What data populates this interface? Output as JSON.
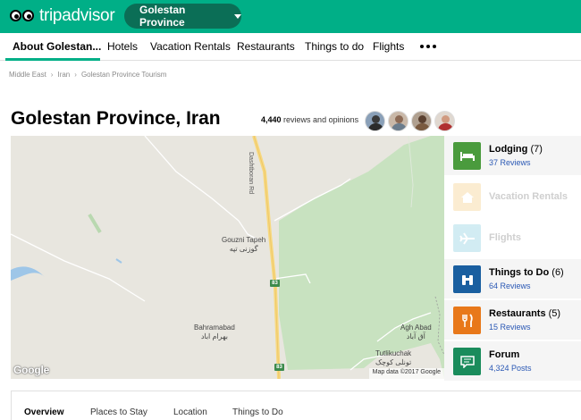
{
  "header": {
    "logo_text": "tripadvisor",
    "geo_pill_label": "Golestan Province",
    "brand_color": "#00af87",
    "pill_color": "#0b6e56"
  },
  "nav": {
    "tabs": [
      "About Golestan...",
      "Hotels",
      "Vacation Rentals",
      "Restaurants",
      "Things to do",
      "Flights"
    ],
    "active_tab": "About Golestan...",
    "more_icon": "more-dots-icon"
  },
  "breadcrumb": [
    "Middle East",
    "Iran",
    "Golestan Province Tourism"
  ],
  "title": {
    "text": "Golestan Province, Iran",
    "reviews_count": "4,440",
    "reviews_suffix": "reviews and opinions"
  },
  "map": {
    "labels": {
      "road_name": "Dashtboran Rd",
      "gouzni": "Gouzni Tapeh",
      "gouzni_fa": "گوزنی تپه",
      "bahramabad": "Bahramabad",
      "bahramabad_fa": "بهرام اباد",
      "agh_abad": "Agh Abad",
      "agh_abad_fa": "آق آباد",
      "tutlikuchak": "Tutlikuchak",
      "tutlikuchak_fa": "تونلی کوچک"
    },
    "shield_label": "83",
    "google_logo": "Google",
    "attribution": "Map data ©2017 Google"
  },
  "categories": [
    {
      "name": "Lodging",
      "count": "(7)",
      "sub": "37 Reviews",
      "icon": "bed-icon",
      "color": "#4a9b3d",
      "enabled": true
    },
    {
      "name": "Vacation Rentals",
      "count": "",
      "sub": "",
      "icon": "house-icon",
      "color": "#f5c26b",
      "enabled": false
    },
    {
      "name": "Flights",
      "count": "",
      "sub": "",
      "icon": "plane-icon",
      "color": "#6ec3d8",
      "enabled": false
    },
    {
      "name": "Things to Do",
      "count": "(6)",
      "sub": "64 Reviews",
      "icon": "binoculars-icon",
      "color": "#1a5fa0",
      "enabled": true
    },
    {
      "name": "Restaurants",
      "count": "(5)",
      "sub": "15 Reviews",
      "icon": "fork-knife-icon",
      "color": "#e8781a",
      "enabled": true
    },
    {
      "name": "Forum",
      "count": "",
      "sub": "4,324 Posts",
      "icon": "chat-bubble-icon",
      "color": "#1a8c5c",
      "enabled": true
    }
  ],
  "bottom_tabs": [
    "Overview",
    "Places to Stay",
    "Location",
    "Things to Do"
  ],
  "bottom_active": "Overview"
}
